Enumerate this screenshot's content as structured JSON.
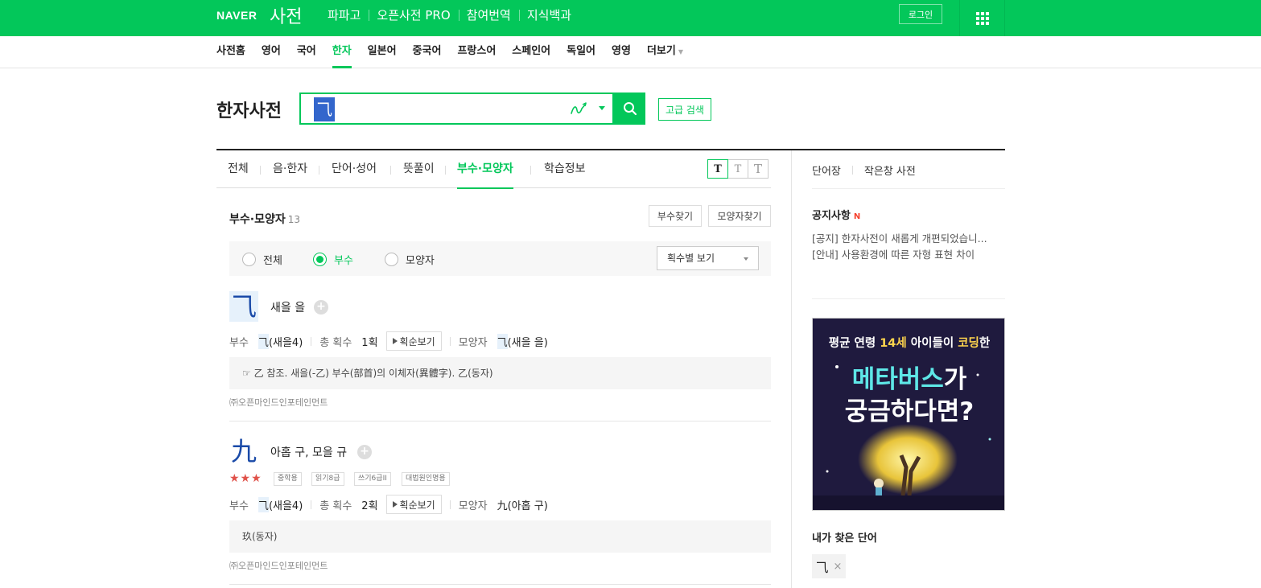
{
  "header": {
    "logo": "NAVER",
    "service": "사전",
    "nav": [
      "파파고",
      "오픈사전 PRO",
      "참여번역",
      "지식백과"
    ],
    "login": "로그인"
  },
  "subnav": {
    "items": [
      "사전홈",
      "영어",
      "국어",
      "한자",
      "일본어",
      "중국어",
      "프랑스어",
      "스페인어",
      "독일어",
      "영영",
      "더보기"
    ],
    "active": "한자"
  },
  "search": {
    "title": "한자사전",
    "query": "⺄",
    "advanced": "고급 검색"
  },
  "tabs": {
    "items": [
      "전체",
      "음·한자",
      "단어·성어",
      "뜻풀이",
      "부수·모양자",
      "학습정보"
    ],
    "active": "부수·모양자",
    "font_sizes": [
      "T",
      "T",
      "T"
    ]
  },
  "section": {
    "title": "부수·모양자",
    "count": "13",
    "buttons": [
      "부수찾기",
      "모양자찾기"
    ],
    "filters": [
      "전체",
      "부수",
      "모양자"
    ],
    "selected_filter": "부수",
    "sort": "획수별 보기"
  },
  "entries": [
    {
      "char": "⺄",
      "meaning": "새을 을",
      "radical_label": "부수",
      "radical_char": "⺄",
      "radical_text": "(새을4)",
      "strokes_label": "총 획수",
      "strokes": "1획",
      "stroke_btn": "획순보기",
      "shape_label": "모양자",
      "shape_char": "⺄",
      "shape_text": "(새을 을)",
      "definition": "☞ 乙 참조. 새을(-乙) 부수(部首)의 이체자(異體字). 乙(동자)",
      "source": "㈜오픈마인드인포테인먼트"
    },
    {
      "char": "九",
      "meaning": "아홉 구, 모을 규",
      "stars": "★★★",
      "badges": [
        "중학용",
        "읽기8급",
        "쓰기6급II",
        "대법원인명용"
      ],
      "radical_label": "부수",
      "radical_char": "⺄",
      "radical_text": "(새을4)",
      "strokes_label": "총 획수",
      "strokes": "2획",
      "stroke_btn": "획순보기",
      "shape_label": "모양자",
      "shape_char": "九",
      "shape_text": "(아홉 구)",
      "definition": "玖(동자)",
      "source": "㈜오픈마인드인포테인먼트"
    }
  ],
  "side": {
    "links": [
      "단어장",
      "작은창 사전"
    ],
    "notice_title": "공지사항",
    "notice_new": "N",
    "notices": [
      "[공지] 한자사전이 새롭게 개편되었습니...",
      "[안내] 사용환경에 따른 자형 표현 차이"
    ],
    "ad": {
      "line1_a": "평균 연령 ",
      "line1_b": "14세",
      "line1_c": " 아이들이 ",
      "line1_d": "코딩",
      "line1_e": "한",
      "line2_a": "메타버스",
      "line2_b": "가",
      "line3": "궁금하다면?"
    },
    "my_words_title": "내가 찾은 단어",
    "my_word": "⺄",
    "my_word_remove": "×"
  },
  "colors": {
    "brand": "#03c75a",
    "hanja": "#1a4aa8",
    "stars": "#e0524a"
  }
}
